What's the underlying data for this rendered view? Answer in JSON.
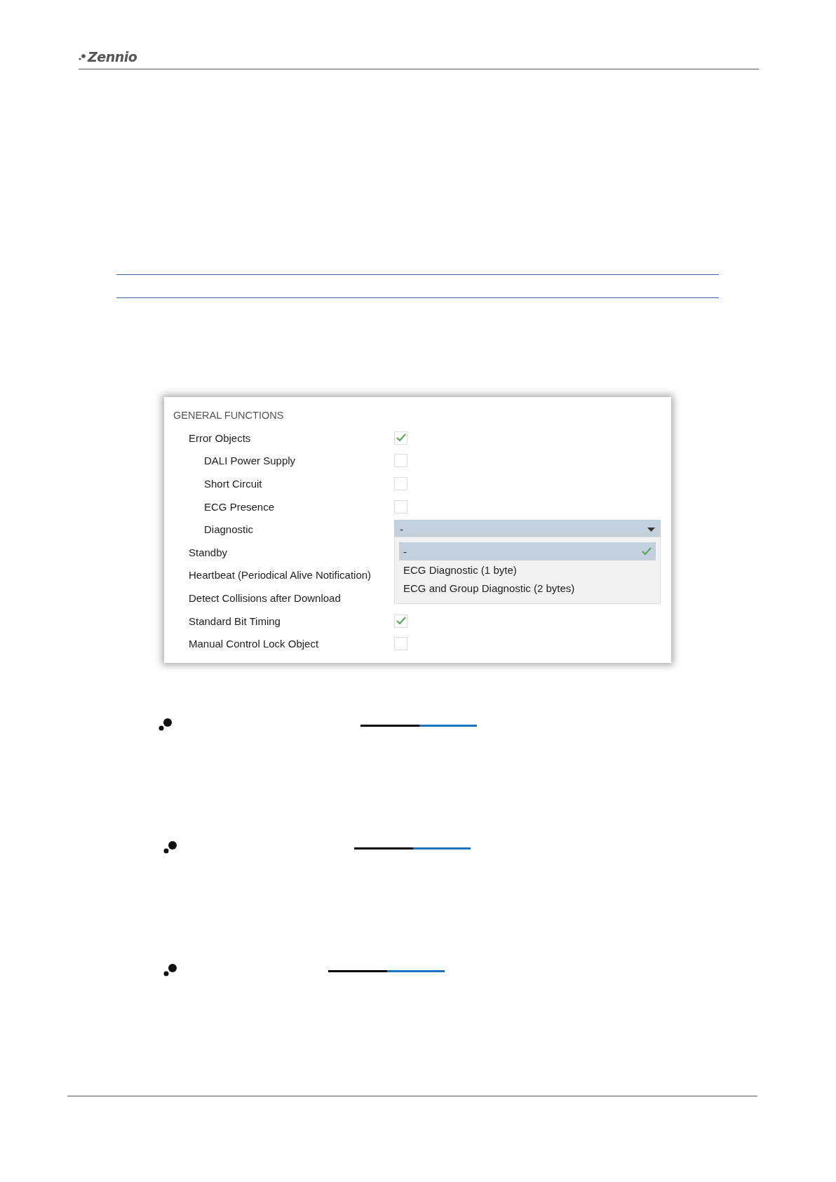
{
  "header": {
    "logo": "Zennio"
  },
  "panel": {
    "title": "GENERAL FUNCTIONS",
    "rows": [
      {
        "label": "Error Objects",
        "kind": "checkbox",
        "checked": true,
        "children": [
          {
            "label": "DALI Power Supply",
            "kind": "checkbox",
            "checked": false
          },
          {
            "label": "Short Circuit",
            "kind": "checkbox",
            "checked": false
          },
          {
            "label": "ECG Presence",
            "kind": "checkbox",
            "checked": false
          },
          {
            "label": "Diagnostic",
            "kind": "dropdown",
            "value": "-",
            "expanded": true,
            "options": [
              {
                "label": "-",
                "selected": true
              },
              {
                "label": "ECG Diagnostic (1 byte)",
                "selected": false
              },
              {
                "label": "ECG and Group Diagnostic (2 bytes)",
                "selected": false
              }
            ]
          }
        ]
      },
      {
        "label": "Standby",
        "kind": "covered"
      },
      {
        "label": "Heartbeat (Periodical Alive Notification)",
        "kind": "covered"
      },
      {
        "label": "Detect Collisions after Download",
        "kind": "covered"
      },
      {
        "label": "Standard Bit Timing",
        "kind": "checkbox",
        "checked": true
      },
      {
        "label": "Manual Control Lock Object",
        "kind": "checkbox",
        "checked": false
      }
    ]
  }
}
